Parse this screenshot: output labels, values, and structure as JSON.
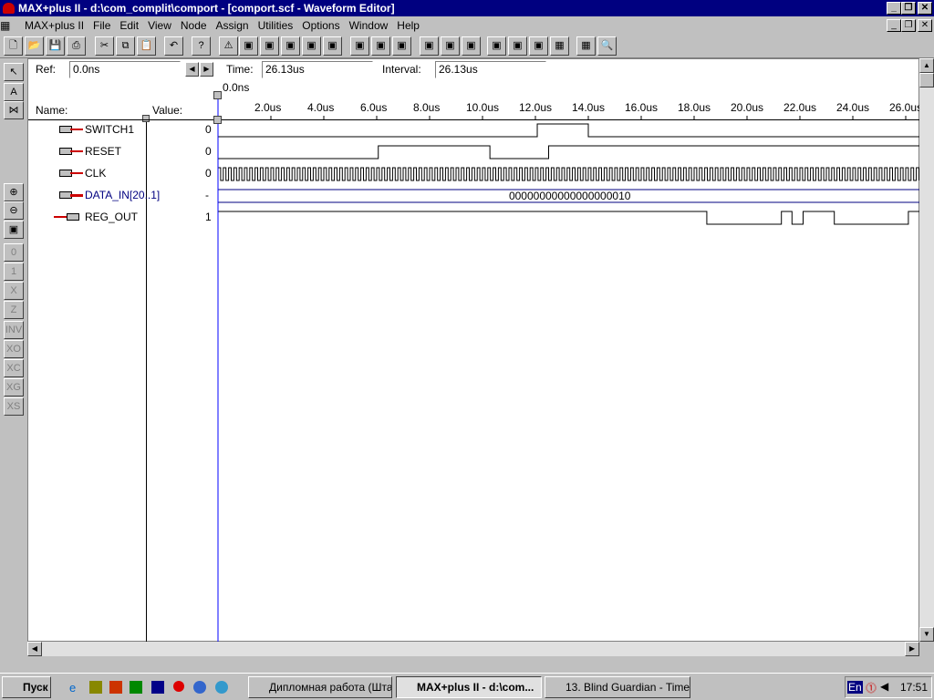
{
  "window": {
    "title": "MAX+plus II - d:\\com_complit\\comport - [comport.scf - Waveform Editor]"
  },
  "menu": [
    "MAX+plus II",
    "File",
    "Edit",
    "View",
    "Node",
    "Assign",
    "Utilities",
    "Options",
    "Window",
    "Help"
  ],
  "toolbar": [
    "new",
    "open",
    "save",
    "print",
    "cut",
    "copy",
    "paste",
    "undo",
    "help",
    "compiler",
    "simulator",
    "timing",
    "waveform",
    "floorplan",
    "programmer",
    "hierarchy",
    "project",
    "save-check",
    "save-all",
    "save-sim",
    "eye-a",
    "eye-ba",
    "eye-bus",
    "eye-color",
    "grid",
    "grid2",
    "find"
  ],
  "header": {
    "ref_label": "Ref:",
    "ref_value": "0.0ns",
    "time_label": "Time:",
    "time_value": "26.13us",
    "interval_label": "Interval:",
    "interval_value": "26.13us",
    "cursor_label": "0.0ns",
    "name_header": "Name:",
    "value_header": "Value:"
  },
  "timescale": {
    "unit": "us",
    "ticks": [
      "2.0us",
      "4.0us",
      "6.0us",
      "8.0us",
      "10.0us",
      "12.0us",
      "14.0us",
      "16.0us",
      "18.0us",
      "20.0us",
      "22.0us",
      "24.0us",
      "26.0us"
    ]
  },
  "signals": [
    {
      "name": "SWITCH1",
      "value": "0",
      "type": "input",
      "init": 0,
      "edges": [
        12.07,
        14.0
      ]
    },
    {
      "name": "RESET",
      "value": "0",
      "type": "input",
      "init": 0,
      "edges": [
        6.06,
        10.28,
        12.5
      ]
    },
    {
      "name": "CLK",
      "value": "0",
      "type": "input",
      "clock_period_us": 0.2
    },
    {
      "name": "DATA_IN[20..1]",
      "value": "-",
      "type": "bus",
      "bus_value": "00000000000000000010"
    },
    {
      "name": "REG_OUT",
      "value": "1",
      "type": "output",
      "init": 1,
      "edges": [
        18.48,
        21.3,
        21.7,
        22.12,
        23.3,
        26.1
      ]
    }
  ],
  "palette": [
    "select",
    "text",
    "connect",
    "zoom-in",
    "zoom-out",
    "fit",
    "0",
    "1",
    "X",
    "Z",
    "INV",
    "XO",
    "XC",
    "XG",
    "XS"
  ],
  "taskbar": {
    "start": "Пуск",
    "tasks": [
      "Дипломная работа (Шта...",
      "MAX+plus II - d:\\com...",
      "13. Blind Guardian - Time ..."
    ],
    "lang": "En",
    "clock": "17:51"
  },
  "colors": {
    "titlebar": "#000080",
    "cursor": "#0000ff",
    "bus": "#000080"
  }
}
